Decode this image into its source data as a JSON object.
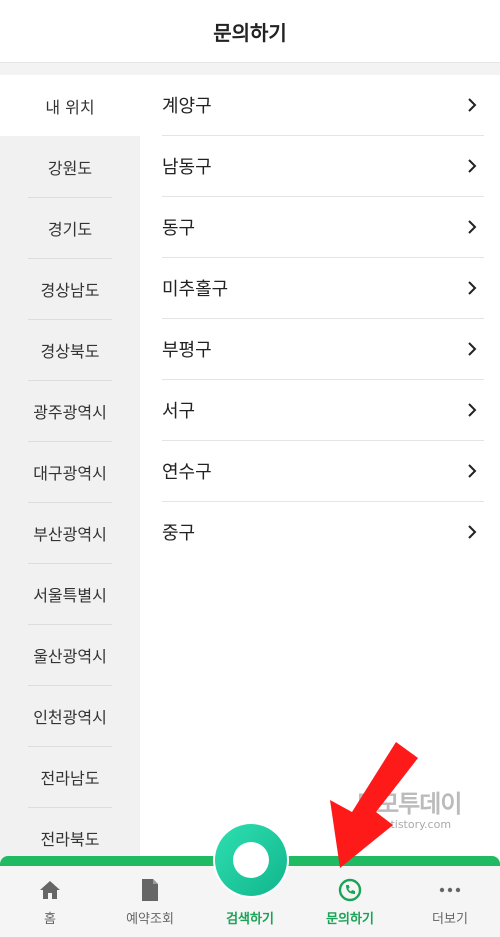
{
  "header": {
    "title": "문의하기"
  },
  "sidebar": {
    "items": [
      {
        "label": "내 위치",
        "active": true
      },
      {
        "label": "강원도"
      },
      {
        "label": "경기도"
      },
      {
        "label": "경상남도"
      },
      {
        "label": "경상북도"
      },
      {
        "label": "광주광역시"
      },
      {
        "label": "대구광역시"
      },
      {
        "label": "부산광역시"
      },
      {
        "label": "서울특별시"
      },
      {
        "label": "울산광역시"
      },
      {
        "label": "인천광역시"
      },
      {
        "label": "전라남도"
      },
      {
        "label": "전라북도"
      }
    ]
  },
  "districts": {
    "items": [
      {
        "label": "계양구"
      },
      {
        "label": "남동구"
      },
      {
        "label": "동구"
      },
      {
        "label": "미추홀구"
      },
      {
        "label": "부평구"
      },
      {
        "label": "서구"
      },
      {
        "label": "연수구"
      },
      {
        "label": "중구"
      }
    ]
  },
  "bottom_nav": {
    "items": [
      {
        "label": "홈",
        "icon": "home-icon"
      },
      {
        "label": "예약조회",
        "icon": "document-icon"
      },
      {
        "label": "검색하기",
        "icon": "search-icon"
      },
      {
        "label": "문의하기",
        "icon": "phone-icon"
      },
      {
        "label": "더보기",
        "icon": "more-icon"
      }
    ]
  },
  "watermark": {
    "title": "모모투데이",
    "url": "pjhhh.tistory.com"
  },
  "colors": {
    "accent": "#1fba62",
    "active_label": "#1aa356",
    "fab": "#16c39a",
    "annotation_arrow": "#ff1a1a"
  }
}
